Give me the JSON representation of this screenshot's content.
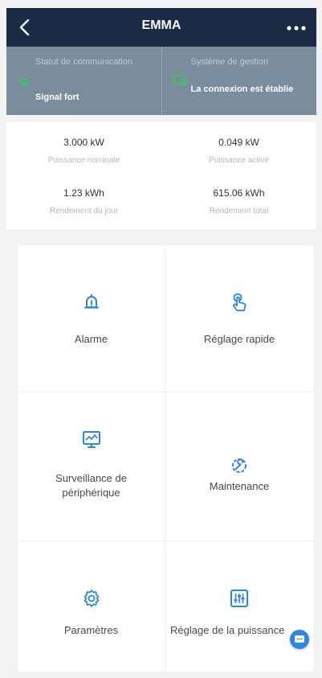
{
  "header": {
    "title": "EMMA"
  },
  "status": {
    "communication": {
      "label": "Statut de communication",
      "value": "Signal fort"
    },
    "management": {
      "label": "Système de gestion",
      "value": "La connexion est établie"
    }
  },
  "stats": [
    {
      "value": "3.000 kW",
      "label": "Puissance nominale"
    },
    {
      "value": "0.049 kW",
      "label": "Puissance active"
    },
    {
      "value": "1.23 kWh",
      "label": "Rendement du jour"
    },
    {
      "value": "615.06 kWh",
      "label": "Rendement total"
    }
  ],
  "menu": [
    {
      "label": "Alarme",
      "icon": "bell-icon"
    },
    {
      "label": "Réglage rapide",
      "icon": "tap-hand-icon"
    },
    {
      "label": "Surveillance de\npériphérique",
      "icon": "monitor-icon"
    },
    {
      "label": "Maintenance",
      "icon": "wrench-gear-icon"
    },
    {
      "label": "Paramètres",
      "icon": "settings-gear-icon"
    },
    {
      "label": "Réglage de la puissance",
      "icon": "sliders-icon"
    }
  ],
  "colors": {
    "header": "#1a2b45",
    "status_bg": "#7a8d9c",
    "accent": "#2a86e8",
    "ok_green": "#3cc46a"
  }
}
